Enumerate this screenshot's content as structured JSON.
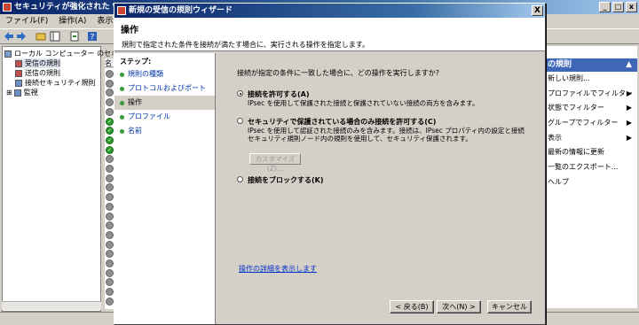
{
  "main_window": {
    "title": "セキュリティが強化された Windo",
    "menu": [
      "ファイル(F)",
      "操作(A)",
      "表示(V)"
    ],
    "tree": [
      {
        "label": "ローカル コンピューター のセキ"
      },
      {
        "label": "受信の規則"
      },
      {
        "label": "送信の規則"
      },
      {
        "label": "接続セキュリティ規則"
      },
      {
        "label": "監視"
      }
    ],
    "expand_glyph": "⊞",
    "rule_header": "名",
    "actions_title": "の規則",
    "actions": [
      {
        "label": "新しい規則...",
        "arrow": ""
      },
      {
        "label": "プロファイルでフィルター",
        "arrow": "▶"
      },
      {
        "label": "状態でフィルター",
        "arrow": "▶"
      },
      {
        "label": "グループでフィルター",
        "arrow": "▶"
      },
      {
        "label": "表示",
        "arrow": "▶"
      },
      {
        "label": "最新の情報に更新",
        "arrow": ""
      },
      {
        "label": "一覧のエクスポート...",
        "arrow": ""
      },
      {
        "label": "ヘルプ",
        "arrow": ""
      }
    ],
    "enabled_rule_rows": [
      5,
      6,
      7,
      8
    ]
  },
  "wizard": {
    "title": "新規の受信の規則ウィザード",
    "close": "X",
    "header_title": "操作",
    "header_subtitle": "規則で指定された条件を接続が満たす場合に、実行される操作を指定します。",
    "steps_label": "ステップ:",
    "steps": [
      {
        "label": "規則の種類",
        "active": false
      },
      {
        "label": "プロトコルおよびポート",
        "active": false
      },
      {
        "label": "操作",
        "active": true
      },
      {
        "label": "プロファイル",
        "active": false
      },
      {
        "label": "名前",
        "active": false
      }
    ],
    "question": "接続が指定の条件に一致した場合に、どの操作を実行しますか?",
    "options": [
      {
        "label": "接続を許可する(A)",
        "desc": [
          "IPsec を使用して保護された接続と保護されていない接続の両方を含みます。"
        ],
        "checked": true
      },
      {
        "label": "セキュリティで保護されている場合のみ接続を許可する(C)",
        "desc": [
          "IPsec を使用して認証された接続のみを含みます。接続は、IPsec プロパティ内の設定と接続",
          "セキュリティ規則ノード内の規則を使用して、セキュリティ保護されます。"
        ],
        "checked": false
      },
      {
        "label": "接続をブロックする(K)",
        "desc": [],
        "checked": false
      }
    ],
    "customize_button": "カスタマイズ(Z)...",
    "details_link": "操作の詳細を表示します",
    "back_button": "< 戻る(B)",
    "next_button": "次へ(N) >",
    "cancel_button": "キャンセル"
  }
}
